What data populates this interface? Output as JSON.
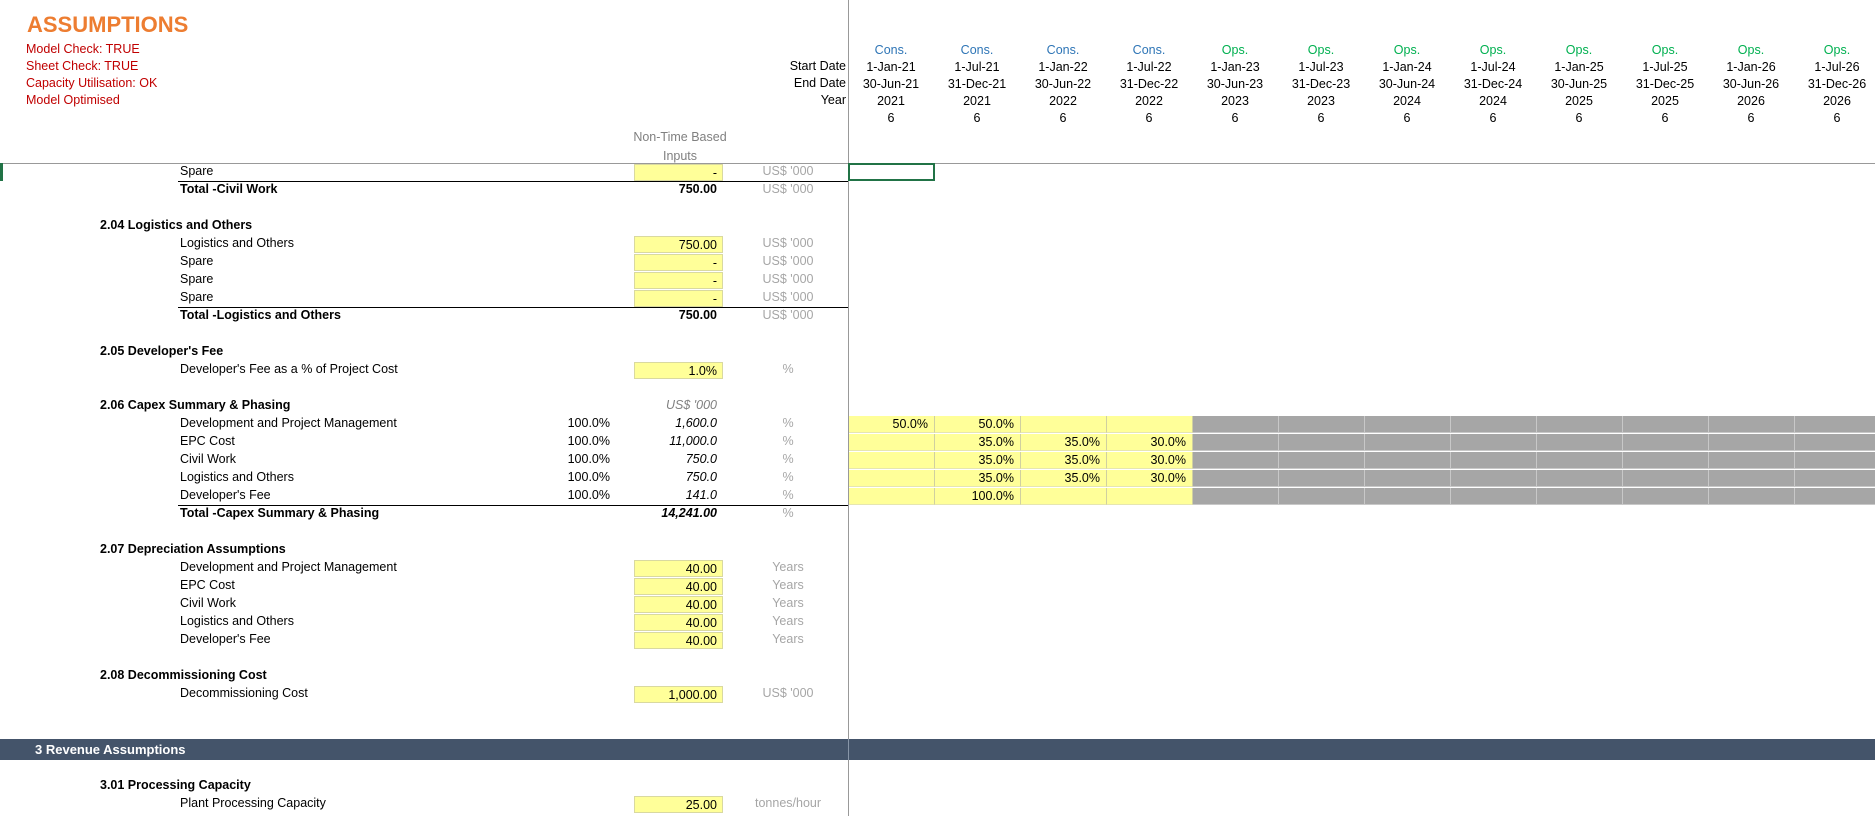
{
  "sheet_title": "ASSUMPTIONS",
  "checks": [
    "Model Check: TRUE",
    "Sheet Check: TRUE",
    "Capacity Utilisation: OK",
    "Model Optimised"
  ],
  "header_labels": {
    "start": "Start Date",
    "end": "End Date",
    "year": "Year"
  },
  "periods": [
    {
      "phase": "Cons.",
      "start": "1-Jan-21",
      "end": "30-Jun-21",
      "year": "2021",
      "months": "6"
    },
    {
      "phase": "Cons.",
      "start": "1-Jul-21",
      "end": "31-Dec-21",
      "year": "2021",
      "months": "6"
    },
    {
      "phase": "Cons.",
      "start": "1-Jan-22",
      "end": "30-Jun-22",
      "year": "2022",
      "months": "6"
    },
    {
      "phase": "Cons.",
      "start": "1-Jul-22",
      "end": "31-Dec-22",
      "year": "2022",
      "months": "6"
    },
    {
      "phase": "Ops.",
      "start": "1-Jan-23",
      "end": "30-Jun-23",
      "year": "2023",
      "months": "6"
    },
    {
      "phase": "Ops.",
      "start": "1-Jul-23",
      "end": "31-Dec-23",
      "year": "2023",
      "months": "6"
    },
    {
      "phase": "Ops.",
      "start": "1-Jan-24",
      "end": "30-Jun-24",
      "year": "2024",
      "months": "6"
    },
    {
      "phase": "Ops.",
      "start": "1-Jul-24",
      "end": "31-Dec-24",
      "year": "2024",
      "months": "6"
    },
    {
      "phase": "Ops.",
      "start": "1-Jan-25",
      "end": "30-Jun-25",
      "year": "2025",
      "months": "6"
    },
    {
      "phase": "Ops.",
      "start": "1-Jul-25",
      "end": "31-Dec-25",
      "year": "2025",
      "months": "6"
    },
    {
      "phase": "Ops.",
      "start": "1-Jan-26",
      "end": "30-Jun-26",
      "year": "2026",
      "months": "6"
    },
    {
      "phase": "Ops.",
      "start": "1-Jul-26",
      "end": "31-Dec-26",
      "year": "2026",
      "months": "6"
    }
  ],
  "non_time_header": "Non-Time Based Inputs",
  "civil": {
    "spare_label": "Spare",
    "spare_value": "-",
    "total_label": "Total -Civil Work",
    "total_value": "750.00",
    "unit": "US$ '000"
  },
  "logistics": {
    "heading": "2.04  Logistics and Others",
    "rows": [
      {
        "label": "Logistics and Others",
        "value": "750.00",
        "unit": "US$ '000"
      },
      {
        "label": "Spare",
        "value": "-",
        "unit": "US$ '000"
      },
      {
        "label": "Spare",
        "value": "-",
        "unit": "US$ '000"
      },
      {
        "label": "Spare",
        "value": "-",
        "unit": "US$ '000"
      }
    ],
    "total_label": "Total -Logistics and Others",
    "total_value": "750.00",
    "total_unit": "US$ '000"
  },
  "dev_fee": {
    "heading": "2.05  Developer's Fee",
    "label": "Developer's Fee as a % of Project Cost",
    "value": "1.0%",
    "unit": "%"
  },
  "capex": {
    "heading": "2.06  Capex Summary & Phasing",
    "unit_header": "US$ '000",
    "rows": [
      {
        "label": "Development and Project Management",
        "pct": "100.0%",
        "value": "1,600.0",
        "unit": "%",
        "phasing": [
          "50.0%",
          "50.0%",
          "",
          ""
        ]
      },
      {
        "label": "EPC Cost",
        "pct": "100.0%",
        "value": "11,000.0",
        "unit": "%",
        "phasing": [
          "",
          "35.0%",
          "35.0%",
          "30.0%"
        ]
      },
      {
        "label": "Civil Work",
        "pct": "100.0%",
        "value": "750.0",
        "unit": "%",
        "phasing": [
          "",
          "35.0%",
          "35.0%",
          "30.0%"
        ]
      },
      {
        "label": "Logistics and Others",
        "pct": "100.0%",
        "value": "750.0",
        "unit": "%",
        "phasing": [
          "",
          "35.0%",
          "35.0%",
          "30.0%"
        ]
      },
      {
        "label": "Developer's Fee",
        "pct": "100.0%",
        "value": "141.0",
        "unit": "%",
        "phasing": [
          "",
          "100.0%",
          "",
          ""
        ]
      }
    ],
    "total_label": "Total -Capex Summary & Phasing",
    "total_value": "14,241.00",
    "total_unit": "%"
  },
  "depreciation": {
    "heading": "2.07  Depreciation Assumptions",
    "rows": [
      {
        "label": "Development and Project Management",
        "value": "40.00",
        "unit": "Years"
      },
      {
        "label": "EPC Cost",
        "value": "40.00",
        "unit": "Years"
      },
      {
        "label": "Civil Work",
        "value": "40.00",
        "unit": "Years"
      },
      {
        "label": "Logistics and Others",
        "value": "40.00",
        "unit": "Years"
      },
      {
        "label": "Developer's Fee",
        "value": "40.00",
        "unit": "Years"
      }
    ]
  },
  "decommissioning": {
    "heading": "2.08  Decommissioning Cost",
    "label": "Decommissioning Cost",
    "value": "1,000.00",
    "unit": "US$ '000"
  },
  "revenue_band": "3  Revenue Assumptions",
  "processing": {
    "heading": "3.01  Processing Capacity",
    "label": "Plant Processing Capacity",
    "value": "25.00",
    "unit": "tonnes/hour"
  }
}
